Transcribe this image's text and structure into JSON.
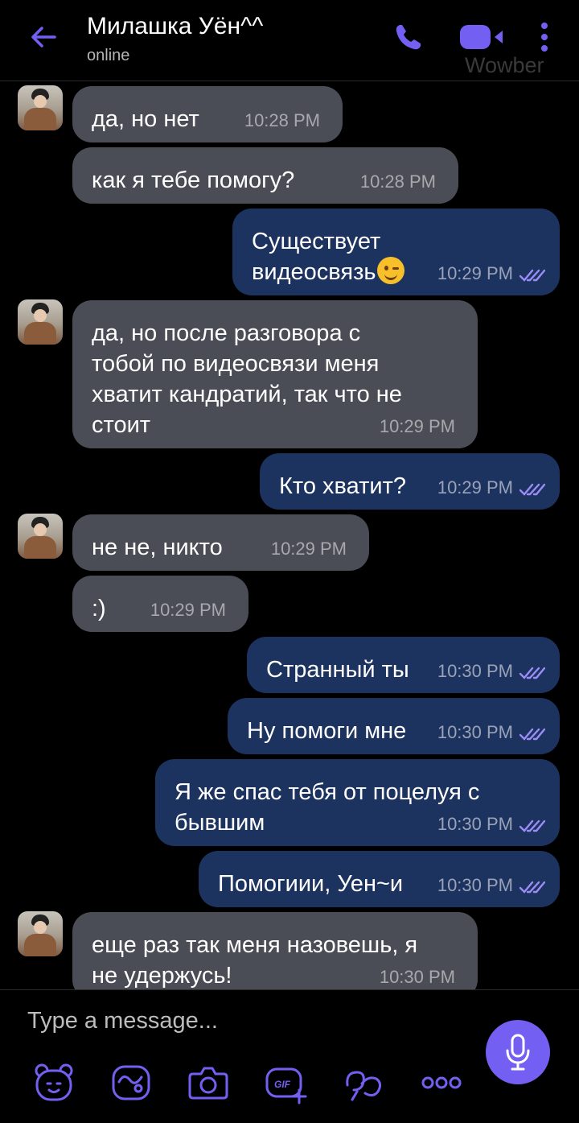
{
  "header": {
    "contact_name": "Милашка Уён^^",
    "status": "online",
    "watermark": "Wowber",
    "icons": [
      "back-arrow-icon",
      "phone-icon",
      "video-call-icon",
      "more-options-icon"
    ]
  },
  "colors": {
    "accent": "#7360f2",
    "incoming_bubble": "#4a4d55",
    "outgoing_bubble": "#1c3360",
    "background": "#000000"
  },
  "messages": [
    {
      "direction": "in",
      "text": "да, но нет",
      "time": "10:28 PM",
      "avatar": true
    },
    {
      "direction": "in",
      "text": "как я тебе помогу?",
      "time": "10:28 PM",
      "avatar": false
    },
    {
      "direction": "out",
      "text_line1": "Существует",
      "text_line2": "видеосвязь",
      "emoji": "winking-face",
      "time": "10:29 PM",
      "read": true
    },
    {
      "direction": "in",
      "text_lines": [
        "да, но после разговора с",
        "тобой по видеосвязи меня",
        "хватит кандратий, так что не",
        "стоит"
      ],
      "time": "10:29 PM",
      "avatar": true
    },
    {
      "direction": "out",
      "text": "Кто хватит?",
      "time": "10:29 PM",
      "read": true
    },
    {
      "direction": "in",
      "text": "не не, никто",
      "time": "10:29 PM",
      "avatar": true
    },
    {
      "direction": "in",
      "text": ":)",
      "time": "10:29 PM",
      "avatar": false
    },
    {
      "direction": "out",
      "text": "Странный ты",
      "time": "10:30 PM",
      "read": true
    },
    {
      "direction": "out",
      "text": "Ну помоги мне",
      "time": "10:30 PM",
      "read": true
    },
    {
      "direction": "out",
      "text_lines": [
        "Я же спас тебя от поцелуя с",
        "бывшим"
      ],
      "time": "10:30 PM",
      "read": true
    },
    {
      "direction": "out",
      "text": "Помогиии, Уен~и",
      "time": "10:30 PM",
      "read": true
    },
    {
      "direction": "in",
      "text_lines": [
        "еще раз так меня назовешь, я",
        "не удержусь!"
      ],
      "time": "10:30 PM",
      "avatar": true
    }
  ],
  "composer": {
    "placeholder": "Type a message...",
    "tools": [
      "sticker-bear-icon",
      "doodle-icon",
      "camera-icon",
      "gif-icon",
      "more-features-icon",
      "more-icon"
    ],
    "gif_label": "GIF",
    "send_icon": "microphone-icon"
  }
}
